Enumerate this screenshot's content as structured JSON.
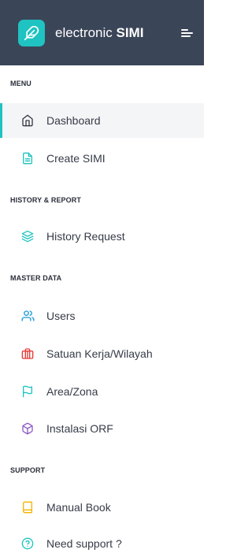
{
  "brand": {
    "prefix": "electronic",
    "name": "SIMI"
  },
  "sections": {
    "menu": "MENU",
    "history": "HISTORY & REPORT",
    "master": "MASTER DATA",
    "support": "SUPPORT"
  },
  "items": {
    "dashboard": "Dashboard",
    "create_simi": "Create SIMI",
    "history_request": "History Request",
    "users": "Users",
    "satuan_kerja": "Satuan Kerja/Wilayah",
    "area_zona": "Area/Zona",
    "instalasi_orf": "Instalasi ORF",
    "manual_book": "Manual Book",
    "need_support": "Need support ?"
  },
  "colors": {
    "header_bg": "#3a4558",
    "accent": "#1fc3c1",
    "users_icon": "#1a9ad6",
    "satuan_icon": "#e53935",
    "area_icon": "#1fc3c1",
    "orf_icon": "#8e5cc4",
    "manual_icon": "#f5b400",
    "support_icon": "#1fc3c1"
  },
  "icons": {
    "logo": "feather-icon",
    "toggle": "hamburger-menu-icon",
    "dashboard": "home-icon",
    "create_simi": "document-icon",
    "history_request": "layers-icon",
    "users": "users-icon",
    "satuan_kerja": "building-icon",
    "area_zona": "flag-icon",
    "instalasi_orf": "package-icon",
    "manual_book": "book-icon",
    "need_support": "help-circle-icon"
  },
  "active_item": "dashboard"
}
